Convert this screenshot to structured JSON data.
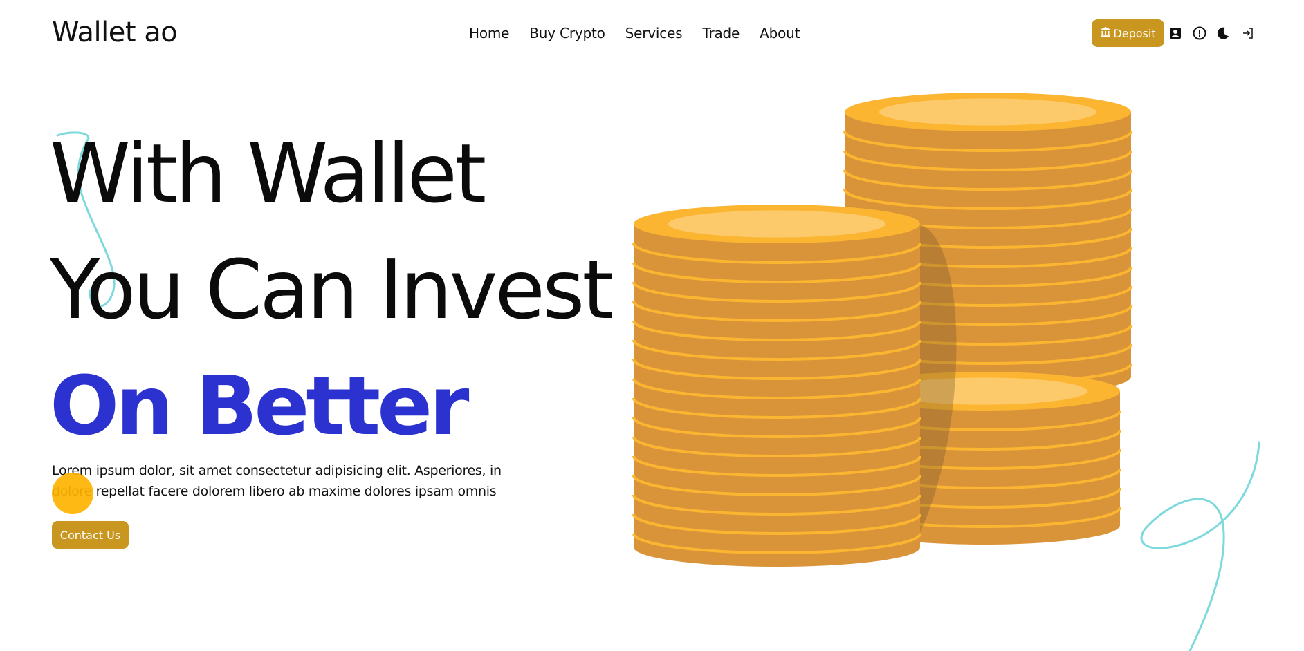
{
  "brand": {
    "name": "Wallet ao"
  },
  "nav": {
    "links": [
      "Home",
      "Buy Crypto",
      "Services",
      "Trade",
      "About"
    ],
    "deposit_label": "Deposit"
  },
  "icons": {
    "deposit": "bank-icon",
    "profile": "user-card-icon",
    "info": "alert-circle-icon",
    "theme": "moon-icon",
    "login": "sign-in-icon"
  },
  "hero": {
    "line1": "With Wallet",
    "line2": "You Can Invest",
    "line3": "On Better",
    "description": "Lorem ipsum dolor, sit amet consectetur adipisicing elit. Asperiores, in dolore repellat facere dolorem libero ab maxime dolores ipsam omnis",
    "cta_label": "Contact Us"
  },
  "colors": {
    "accent": "#c9961f",
    "highlight": "#2b32cf",
    "coin": "#d9943a",
    "coin_rim": "#fbb531",
    "coin_top": "#fdca6b",
    "decor_line": "#7ed9dc",
    "cursor": "#ffb300"
  }
}
